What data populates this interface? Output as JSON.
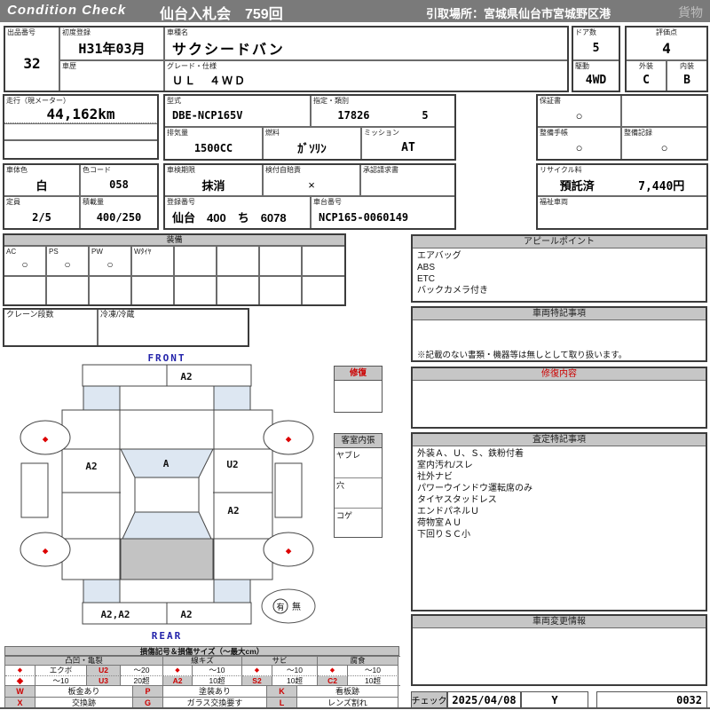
{
  "header": {
    "brand": "Condition  Check",
    "auction_title": "仙台入札会　759回",
    "pickup_location": "引取場所：宮城県仙台市宮城野区港",
    "category": "貨物"
  },
  "vehicle": {
    "exhibit_no": {
      "label": "出品番号",
      "value": "32"
    },
    "first_registration": {
      "label": "初度登録",
      "value": "H31年03月"
    },
    "history": {
      "label": "車歴",
      "value": ""
    },
    "model_name": {
      "label": "車種名",
      "value": "サクシードバン"
    },
    "grade": {
      "label": "グレード・仕様",
      "value": "ＵＬ　４ＷＤ"
    },
    "doors": {
      "label": "ドア数",
      "value": "5"
    },
    "score": {
      "label": "評価点",
      "value": "4"
    },
    "drive": {
      "label": "駆動",
      "value": "4WD"
    },
    "exterior": {
      "label": "外装",
      "value": "C"
    },
    "interior": {
      "label": "内装",
      "value": "B"
    },
    "mileage": {
      "label": "走行（現メーター）",
      "value": "44,162km"
    },
    "model_code": {
      "label": "型式",
      "value": "DBE-NCP165V"
    },
    "class_type": {
      "label": "指定・類別",
      "value1": "17826",
      "value2": "5"
    },
    "displacement": {
      "label": "排気量",
      "value": "1500CC"
    },
    "fuel": {
      "label": "燃料",
      "value": "ｶﾞｿﾘﾝ"
    },
    "transmission": {
      "label": "ミッション",
      "value": "AT"
    },
    "warranty": {
      "label": "保証書",
      "value": "○"
    },
    "maintenance_book": {
      "label": "整備手帳",
      "value": "○"
    },
    "maintenance_record": {
      "label": "整備記録",
      "value": "○"
    },
    "body_color": {
      "label": "車体色",
      "value": "白"
    },
    "color_code": {
      "label": "色コード",
      "value": "058"
    },
    "inspection_expiry": {
      "label": "車検期限",
      "value": "抹消"
    },
    "liability_insurance": {
      "label": "検付自賠責",
      "value": "×"
    },
    "approval_request": {
      "label": "承認請求書",
      "value": ""
    },
    "capacity": {
      "label": "定員",
      "value": "2/5"
    },
    "load_capacity": {
      "label": "積載量",
      "value": "400/250"
    },
    "registration_no": {
      "label": "登録番号",
      "value": "仙台　400　ち　6078"
    },
    "chassis_no": {
      "label": "車台番号",
      "value": "NCP165-0060149"
    },
    "recycle": {
      "label": "リサイクル料",
      "status": "預託済",
      "fee": "7,440円"
    },
    "welfare": {
      "label": "福祉車両",
      "value": ""
    }
  },
  "equipment": {
    "title": "装備",
    "cells": [
      {
        "label": "AC",
        "mark": "○"
      },
      {
        "label": "PS",
        "mark": "○"
      },
      {
        "label": "PW",
        "mark": "○"
      },
      {
        "label": "Wﾀｲﾔ",
        "mark": ""
      }
    ],
    "crane": {
      "label": "クレーン段数",
      "value": ""
    },
    "freezer": {
      "label": "冷凍/冷蔵",
      "value": ""
    }
  },
  "appeal": {
    "title": "アピールポイント",
    "items": [
      "エアバッグ",
      "ABS",
      "ETC",
      "バックカメラ付き"
    ]
  },
  "vehicle_notes": {
    "title": "車両特記事項",
    "note": "※記載のない書類・機器等は無しとして取り扱います。"
  },
  "repair_content": {
    "title": "修復内容",
    "body": ""
  },
  "appraisal_notes": {
    "title": "査定特記事項",
    "items": [
      "外装Ａ、Ｕ、Ｓ、鉄粉付着",
      "室内汚れ/スレ",
      "社外ナビ",
      "パワーウインドウ運転席のみ",
      "タイヤスタッドレス",
      "エンドパネルＵ",
      "荷物室ＡＵ",
      "下回りＳＣ小"
    ]
  },
  "change_info": {
    "title": "車両変更情報",
    "body": ""
  },
  "check": {
    "label": "チェック",
    "date": "2025/04/08",
    "inspector": "Y",
    "sheet_no": "0032"
  },
  "diagram": {
    "front_label": "FRONT",
    "rear_label": "REAR",
    "front_bumper_mark": "A2",
    "windshield_mark": "A",
    "left_side_mark": "A2",
    "right_side_upper_mark": "U2",
    "right_side_lower_mark": "A2",
    "rear_bumper_left_mark": "A2,A2",
    "rear_bumper_right_mark": "A2",
    "tire_mark": "◆",
    "spare_yes": "有",
    "spare_no": "無",
    "repair_box_title": "修復",
    "cabin_box": {
      "title": "客室内張",
      "rows": [
        "ヤブレ",
        "穴",
        "コゲ"
      ]
    },
    "colors": {
      "panel_blue": "#dde7f2",
      "panel_gray": "#c3c3c3",
      "mark_red": "#dd0000",
      "front_rear_blue": "#2222aa"
    }
  },
  "legend": {
    "title": "損傷記号＆損傷サイズ（～最大cm）",
    "dent": {
      "header": "凸凹・亀裂",
      "r1": [
        "◆",
        "エクボ",
        "U2",
        "～20"
      ],
      "r2": [
        "◆",
        "～10",
        "U3",
        "20超"
      ]
    },
    "scratch": {
      "header": "線キズ",
      "r1": [
        "◆",
        "～10"
      ],
      "r2": [
        "A2",
        "10超"
      ]
    },
    "rust": {
      "header": "サビ",
      "r1": [
        "◆",
        "～10"
      ],
      "r2": [
        "S2",
        "10超"
      ]
    },
    "corrosion": {
      "header": "腐食",
      "r1": [
        "◆",
        "～10"
      ],
      "r2": [
        "C2",
        "10超"
      ]
    },
    "marks": [
      {
        "code": "W",
        "desc": "板金あり"
      },
      {
        "code": "P",
        "desc": "塗装あり"
      },
      {
        "code": "K",
        "desc": "看板跡"
      },
      {
        "code": "X",
        "desc": "交換跡"
      },
      {
        "code": "G",
        "desc": "ガラス交換要す"
      },
      {
        "code": "L",
        "desc": "レンズ割れ"
      }
    ]
  }
}
